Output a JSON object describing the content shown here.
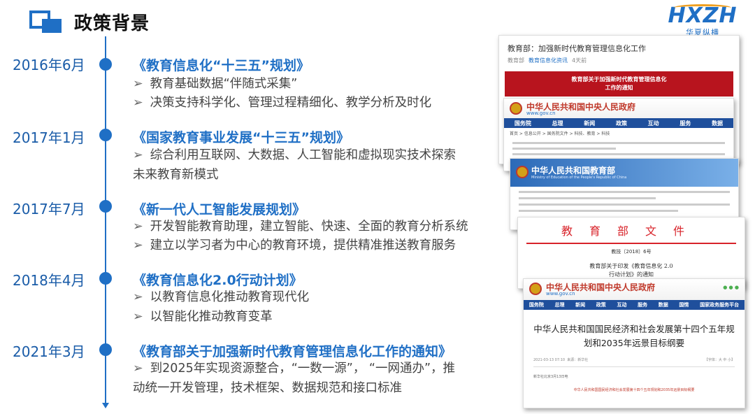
{
  "header": {
    "title": "政策背景",
    "logo_mark": "HXZH",
    "logo_sub": "华夏纵横"
  },
  "colors": {
    "accent": "#1f6fc5",
    "date_text": "#1a5ca8",
    "red": "#d8232a"
  },
  "timeline": [
    {
      "date": "2016年6月",
      "title": "《教育信息化“十三五”规划》",
      "bullets": [
        "教育基础数据“伴随式采集”",
        "决策支持科学化、管理过程精细化、教学分析及时化"
      ]
    },
    {
      "date": "2017年1月",
      "title": "《国家教育事业发展“十三五”规划》",
      "bullets": [
        "综合利用互联网、大数据、人工智能和虚拟现实技术探索"
      ],
      "continuation": "未来教育新模式"
    },
    {
      "date": "2017年7月",
      "title": "《新一代人工智能发展规划》",
      "bullets": [
        "开发智能教育助理，建立智能、快速、全面的教育分析系统",
        "建立以学习者为中心的教育环境，提供精准推送教育服务"
      ]
    },
    {
      "date": "2018年4月",
      "title": "《教育信息化2.0行动计划》",
      "bullets": [
        "以教育信息化推动教育现代化",
        "以智能化推动教育变革"
      ]
    },
    {
      "date": "2021年3月",
      "title": "《教育部关于加强新时代教育管理信息化工作的通知》",
      "bullets": [
        "到2025年实现资源整合，“一数一源”，  “一网通办”，推"
      ],
      "continuation": "动统一开发管理，技术框架、数据规范和接口标准"
    }
  ],
  "bullet_glyph": "➢",
  "documents": {
    "doc1": {
      "heading": "教育部：加强新时代教育管理信息化工作",
      "meta_source": "教育部",
      "meta_link": "教育信息化资讯",
      "meta_time": "4天前",
      "banner_line1": "教育部关于加强新时代教育管理信息化",
      "banner_line2": "工作的通知"
    },
    "gov": {
      "name": "中华人民共和国中央人民政府",
      "url": "www.gov.cn",
      "nav": [
        "国务院",
        "总理",
        "新闻",
        "政策",
        "互动",
        "服务",
        "数据"
      ],
      "crumb": "首页 > 信息公开 > 国务院文件 > 科技、教育 > 科技"
    },
    "moe": {
      "name": "中华人民共和国教育部",
      "sub": "Ministry of Education of the People's Republic of China"
    },
    "doc4": {
      "heading": "教育部文件",
      "number": "教技〔2018〕6号",
      "subject_line1": "教育部关于印发《教育信息化 2.0",
      "subject_line2": "行动计划》的通知"
    },
    "doc5": {
      "name": "中华人民共和国中央人民政府",
      "url": "www.gov.cn",
      "nav": [
        "国务院",
        "总理",
        "新闻",
        "政策",
        "互动",
        "服务",
        "数据",
        "国情",
        "国家政务服务平台"
      ],
      "title_line1": "中华人民共和国国民经济和社会发展第十四个五年规",
      "title_line2": "划和2035年远景目标纲要",
      "date": "2021-03-13 07:10",
      "source": "来源：新华社",
      "font_size": "【字体：大 中 小】",
      "note": "新华社北京3月13日电",
      "footer": "中华人民共和国国民经济和社会发展第十四个五年规划和2035年远景目标纲要"
    }
  }
}
